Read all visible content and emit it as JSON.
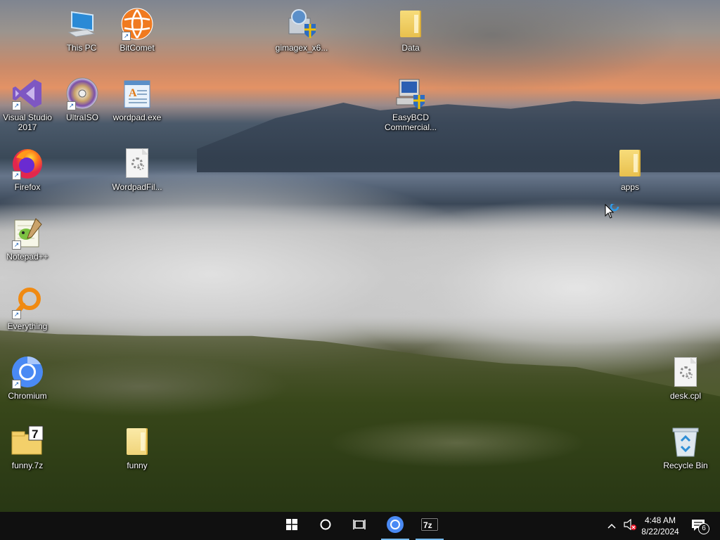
{
  "desktop": {
    "icons": [
      {
        "id": "this-pc",
        "label": "This PC",
        "icon": "computer-icon"
      },
      {
        "id": "bitcomet",
        "label": "BitComet",
        "icon": "bitcomet-icon"
      },
      {
        "id": "gimagex",
        "label": "gimagex_x6...",
        "icon": "installer-icon"
      },
      {
        "id": "data",
        "label": "Data",
        "icon": "folder-icon"
      },
      {
        "id": "visual-studio",
        "label": "Visual Studio 2017",
        "icon": "visual-studio-icon"
      },
      {
        "id": "ultraiso",
        "label": "UltraISO",
        "icon": "disc-icon"
      },
      {
        "id": "wordpad",
        "label": "wordpad.exe",
        "icon": "wordpad-icon"
      },
      {
        "id": "easybcd",
        "label": "EasyBCD Commercial...",
        "icon": "easybcd-icon"
      },
      {
        "id": "firefox",
        "label": "Firefox",
        "icon": "firefox-icon"
      },
      {
        "id": "wordpadfile",
        "label": "WordpadFil...",
        "icon": "settings-file-icon"
      },
      {
        "id": "apps",
        "label": "apps",
        "icon": "folder-icon"
      },
      {
        "id": "notepadpp",
        "label": "Notepad++",
        "icon": "notepadpp-icon"
      },
      {
        "id": "everything",
        "label": "Everything",
        "icon": "search-icon"
      },
      {
        "id": "chromium",
        "label": "Chromium",
        "icon": "chromium-icon"
      },
      {
        "id": "desk-cpl",
        "label": "desk.cpl",
        "icon": "settings-file-icon"
      },
      {
        "id": "funny-7z",
        "label": "funny.7z",
        "icon": "archive-icon"
      },
      {
        "id": "funny",
        "label": "funny",
        "icon": "folder-icon"
      },
      {
        "id": "recycle-bin",
        "label": "Recycle Bin",
        "icon": "recycle-bin-icon"
      }
    ]
  },
  "taskbar": {
    "buttons": [
      {
        "id": "start",
        "icon": "windows-logo-icon"
      },
      {
        "id": "search",
        "icon": "cortana-circle-icon"
      },
      {
        "id": "task-view",
        "icon": "task-view-icon"
      },
      {
        "id": "chromium",
        "icon": "chromium-icon"
      },
      {
        "id": "7zip",
        "icon": "7zip-icon"
      }
    ],
    "tray": {
      "time": "4:48 AM",
      "date": "8/22/2024",
      "notification_count": "6"
    }
  },
  "colors": {
    "taskbar_bg": "#101010",
    "accent": "#76b9ed"
  }
}
